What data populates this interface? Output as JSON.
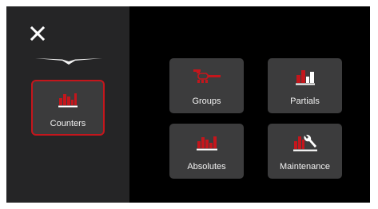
{
  "sidebar": {
    "items": [
      {
        "label": "Counters",
        "icon": "counters-bar-chart-icon",
        "selected": true
      }
    ]
  },
  "tiles": [
    {
      "label": "Groups",
      "icon": "groups-wrench-icon"
    },
    {
      "label": "Partials",
      "icon": "partials-bar-chart-icon"
    },
    {
      "label": "Absolutes",
      "icon": "absolutes-bar-chart-icon"
    },
    {
      "label": "Maintenance",
      "icon": "maintenance-wrench-icon"
    }
  ],
  "colors": {
    "accent": "#c4161c",
    "tile_background": "#3c3c3d",
    "sidebar_background": "#252526",
    "main_background": "#000000",
    "text": "#f2f2f2"
  }
}
